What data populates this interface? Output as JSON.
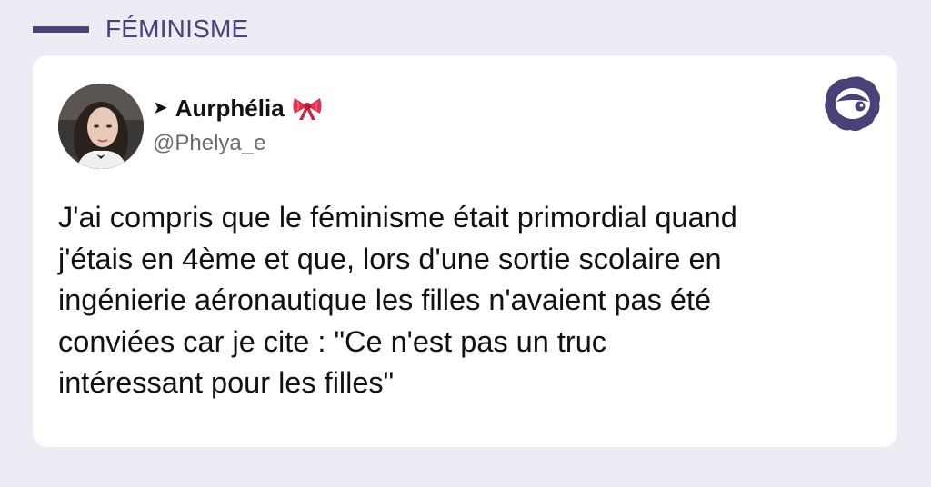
{
  "category": {
    "label": "FÉMINISME"
  },
  "tweet": {
    "author": {
      "prefix_icon": "arrow-right-icon",
      "display_name": "Aurphélia",
      "emoji_icon": "ribbon-bow-icon",
      "handle": "@Phelya_e"
    },
    "text_lines": [
      "J'ai compris que le féminisme était primordial quand",
      "j'étais en 4ème et que, lors d'une sortie scolaire en",
      "ingénierie aéronautique les filles n'avaient pas été",
      "conviées car je cite : \"Ce n'est pas un truc",
      "intéressant pour les filles\""
    ]
  },
  "brand": {
    "icon": "brand-logo-icon"
  },
  "colors": {
    "background": "#eeebf5",
    "accent": "#4b4179",
    "card": "#ffffff",
    "text": "#111111",
    "handle": "#6b6b6b",
    "bow": "#e0304f"
  }
}
